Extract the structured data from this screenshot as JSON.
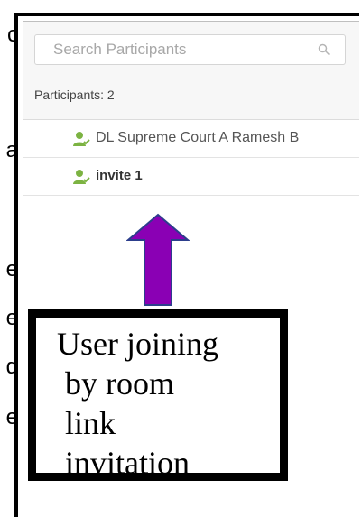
{
  "background_edge_letters": [
    "c",
    "a",
    "e",
    "e",
    "d",
    "e"
  ],
  "search": {
    "placeholder": "Search Participants",
    "icon": "search-icon"
  },
  "participants_label": "Participants: 2",
  "participants": [
    {
      "name": "DL Supreme Court A Ramesh B",
      "icon": "user-icon",
      "bold": false
    },
    {
      "name": "invite 1",
      "icon": "user-icon",
      "bold": true
    }
  ],
  "colors": {
    "user_icon": "#7cb342",
    "arrow_fill": "#8a00b4",
    "arrow_stroke": "#2c3e8c"
  },
  "annotation": {
    "text": "User joining\n by room\n link\n invitation"
  }
}
